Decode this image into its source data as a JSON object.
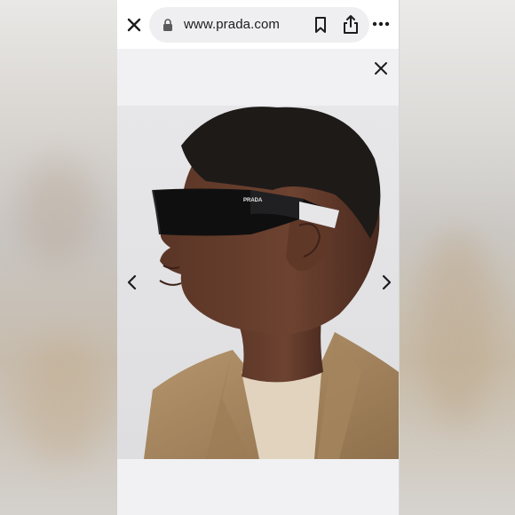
{
  "browser": {
    "url": "www.prada.com",
    "icons": {
      "close": "close-icon",
      "lock": "lock-icon",
      "bookmark": "bookmark-icon",
      "share": "share-icon",
      "more": "more-icon"
    }
  },
  "gallery": {
    "image_alt": "Model wearing wraparound black sunglasses with PRADA logo",
    "logo_text": "PRADA",
    "controls": {
      "close": "close-icon",
      "previous": "chevron-left-icon",
      "next": "chevron-right-icon"
    }
  },
  "colors": {
    "toolbar_bg": "#ffffff",
    "urlbar_bg": "#efeff1",
    "modal_bg": "#f1f1f3",
    "icon": "#1c1c1e"
  }
}
